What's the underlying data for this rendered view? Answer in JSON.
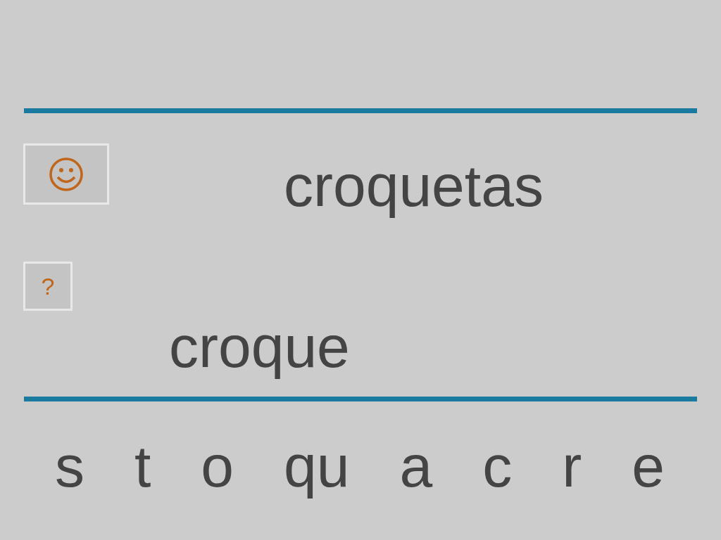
{
  "target_word": "croquetas",
  "hint_button": {
    "label": "?"
  },
  "answer": "croque",
  "letters": [
    "s",
    "t",
    "o",
    "qu",
    "a",
    "c",
    "r",
    "e"
  ]
}
